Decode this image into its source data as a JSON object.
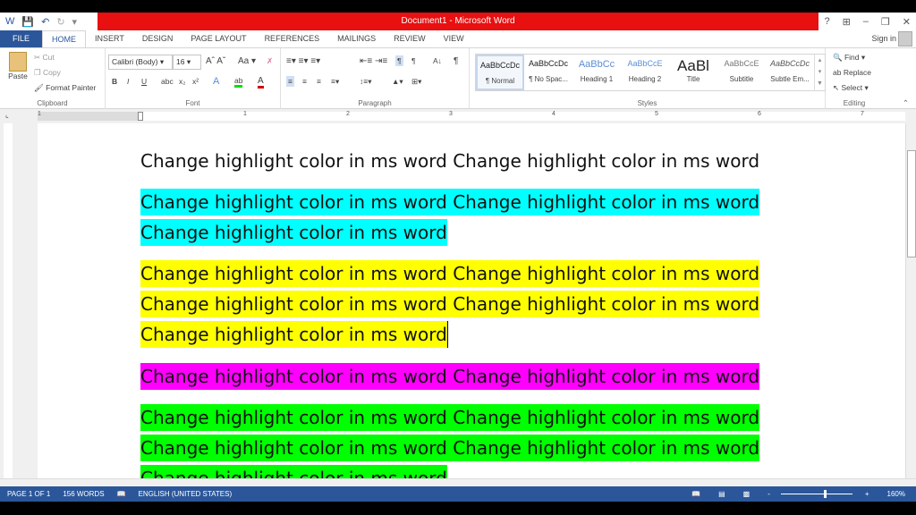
{
  "window": {
    "title": "Document1 - Microsoft Word",
    "controls": [
      "?",
      "restore-ribbon",
      "minimize",
      "restore",
      "close"
    ]
  },
  "qat": {
    "icons": [
      "word-logo-icon",
      "save-icon",
      "undo-icon",
      "redo-icon",
      "customize-icon"
    ]
  },
  "tabs": [
    "FILE",
    "HOME",
    "INSERT",
    "DESIGN",
    "PAGE LAYOUT",
    "REFERENCES",
    "MAILINGS",
    "REVIEW",
    "VIEW"
  ],
  "active_tab": "HOME",
  "account": {
    "signin": "Sign in"
  },
  "clipboard": {
    "paste": "Paste",
    "cut": "Cut",
    "copy": "Copy",
    "format_painter": "Format Painter",
    "label": "Clipboard"
  },
  "font": {
    "name": "Calibri (Body)",
    "size": "16",
    "label": "Font",
    "buttons": [
      "B",
      "I",
      "U",
      "abc",
      "x₂",
      "x²"
    ]
  },
  "paragraph": {
    "label": "Paragraph"
  },
  "styles": {
    "label": "Styles",
    "items": [
      {
        "preview": "AaBbCcDc",
        "name": "¶ Normal"
      },
      {
        "preview": "AaBbCcDc",
        "name": "¶ No Spac..."
      },
      {
        "preview": "AaBbCc",
        "name": "Heading 1"
      },
      {
        "preview": "AaBbCcE",
        "name": "Heading 2"
      },
      {
        "preview": "AaBl",
        "name": "Title"
      },
      {
        "preview": "AaBbCcE",
        "name": "Subtitle"
      },
      {
        "preview": "AaBbCcDc",
        "name": "Subtle Em..."
      }
    ]
  },
  "editing": {
    "find": "Find",
    "replace": "Replace",
    "select": "Select",
    "label": "Editing"
  },
  "ruler": {
    "numbers": [
      "1",
      "1",
      "2",
      "3",
      "4",
      "5",
      "6",
      "7"
    ]
  },
  "document": {
    "lines": [
      {
        "text": "Change highlight color in ms word Change highlight color in ms word",
        "highlight": "none"
      },
      {
        "text": " Change highlight color in ms word Change highlight color in ms word",
        "highlight": "#00ffff"
      },
      {
        "text": "Change highlight color in ms word",
        "highlight": "#00ffff"
      },
      {
        "text": " Change highlight color in ms word Change highlight color in ms word",
        "highlight": "#ffff00"
      },
      {
        "text": "Change highlight color in ms word Change highlight color in ms word",
        "highlight": "#ffff00"
      },
      {
        "text": "Change highlight color in ms word",
        "highlight": "#ffff00"
      },
      {
        "text": " Change highlight color in ms word Change highlight color in ms word",
        "highlight": "#ff00ff"
      },
      {
        "text": "  Change highlight color in ms word Change highlight color in ms word",
        "highlight": "#00ff00"
      },
      {
        "text": "Change highlight color in ms word Change highlight color in ms word",
        "highlight": "#00ff00"
      },
      {
        "text": "Change highlight color in ms word",
        "highlight": "#00ff00"
      }
    ]
  },
  "status": {
    "page": "PAGE 1 OF 1",
    "words": "156 WORDS",
    "language": "ENGLISH (UNITED STATES)",
    "zoom": "160%",
    "zoom_minus": "-",
    "zoom_plus": "+"
  },
  "colors": {
    "accent": "#2b579a",
    "titlebar": "#e81010"
  }
}
